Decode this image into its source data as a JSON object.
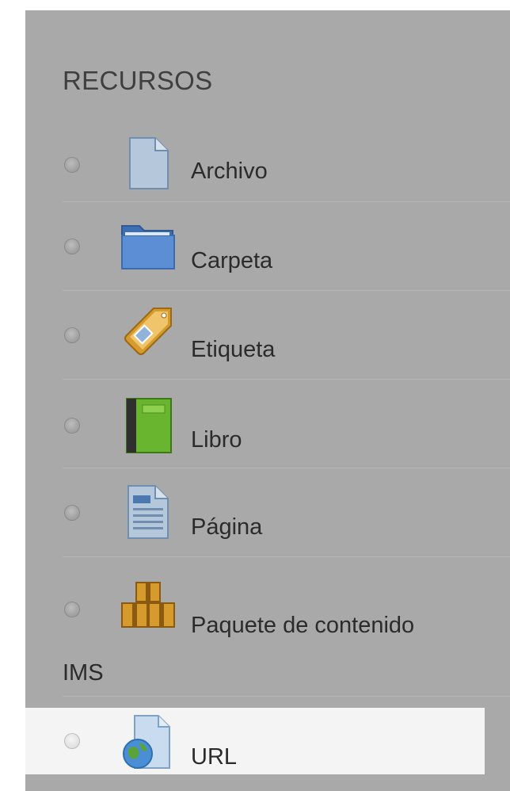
{
  "section": {
    "title": "RECURSOS"
  },
  "items": [
    {
      "label": "Archivo",
      "icon": "file-icon"
    },
    {
      "label": "Carpeta",
      "icon": "folder-icon"
    },
    {
      "label": "Etiqueta",
      "icon": "tag-icon"
    },
    {
      "label": "Libro",
      "icon": "book-icon"
    },
    {
      "label": "Página",
      "icon": "page-icon"
    },
    {
      "label": "Paquete de contenido",
      "label_continued": "IMS",
      "icon": "package-icon"
    },
    {
      "label": "URL",
      "icon": "url-icon",
      "selected": true
    }
  ],
  "colors": {
    "panel_bg": "#a9a9a9",
    "selected_bg": "#f4f4f4",
    "text": "#2b2b2b"
  }
}
